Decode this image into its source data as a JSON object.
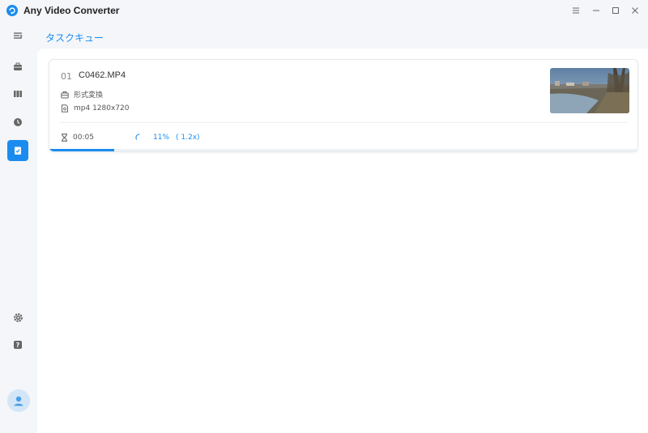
{
  "app": {
    "title": "Any Video Converter",
    "accent": "#1a8cf0"
  },
  "window_controls": [
    "menu-icon",
    "minimize-icon",
    "maximize-icon",
    "close-icon"
  ],
  "sidebar": {
    "items": [
      {
        "name": "collapse-menu",
        "icon": "menu-collapse-icon",
        "active": false
      },
      {
        "name": "convert",
        "icon": "toolbox-icon",
        "active": false
      },
      {
        "name": "edit",
        "icon": "film-icon",
        "active": false
      },
      {
        "name": "history",
        "icon": "clock-icon",
        "active": false
      },
      {
        "name": "task-queue",
        "icon": "task-check-icon",
        "active": true
      },
      {
        "name": "settings",
        "icon": "gear-icon",
        "active": false
      },
      {
        "name": "help",
        "icon": "help-icon",
        "active": false
      },
      {
        "name": "account",
        "icon": "user-icon",
        "active": false
      }
    ]
  },
  "page": {
    "tab_label": "タスクキュー"
  },
  "task": {
    "index": "01",
    "filename": "C0462.MP4",
    "operation": "形式変換",
    "output_format": "mp4 1280x720",
    "elapsed": "00:05",
    "progress_text": "11%",
    "speed_text": "( 1.2x)",
    "progress": 0.11
  }
}
